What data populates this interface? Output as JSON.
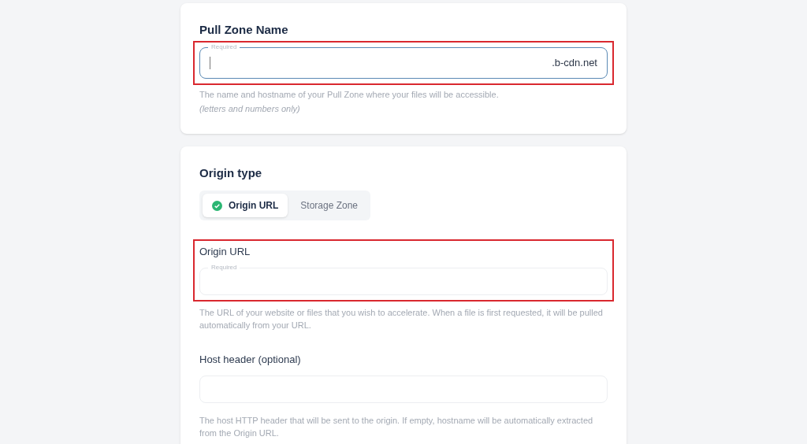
{
  "pull_zone": {
    "title": "Pull Zone Name",
    "field": {
      "floating_label": "Required",
      "suffix": ".b-cdn.net",
      "focused": true,
      "highlighted": true
    },
    "hint": "The name and hostname of your Pull Zone where your files will be accessible.",
    "note": "(letters and numbers only)"
  },
  "origin": {
    "title": "Origin type",
    "tabs": [
      {
        "label": "Origin URL",
        "selected": true
      },
      {
        "label": "Storage Zone",
        "selected": false
      }
    ],
    "fields": [
      {
        "label": "Origin URL",
        "floating_label": "Required",
        "highlighted": true,
        "hint": "The URL of your website or files that you wish to accelerate. When a file is first requested, it will be pulled automatically from your URL."
      },
      {
        "label": "Host header (optional)",
        "highlighted": false,
        "hint": "The host HTTP header that will be sent to the origin. If empty, hostname will be automatically extracted from the Origin URL."
      }
    ]
  }
}
